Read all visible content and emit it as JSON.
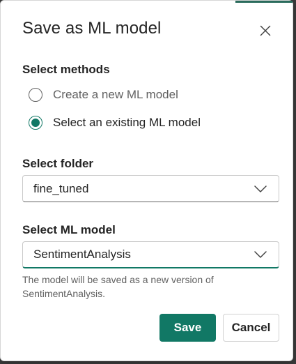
{
  "dialog": {
    "title": "Save as ML model",
    "close_icon": "close-icon",
    "accent_color": "#117865"
  },
  "methods": {
    "label": "Select methods",
    "options": [
      {
        "label": "Create a new ML model",
        "selected": false
      },
      {
        "label": "Select an existing ML model",
        "selected": true
      }
    ]
  },
  "folder": {
    "label": "Select folder",
    "value": "fine_tuned",
    "icon": "chevron-down-icon"
  },
  "model": {
    "label": "Select ML model",
    "value": "SentimentAnalysis",
    "icon": "chevron-down-icon",
    "hint": "The model will be saved as a new version of SentimentAnalysis."
  },
  "actions": {
    "save_label": "Save",
    "cancel_label": "Cancel"
  }
}
